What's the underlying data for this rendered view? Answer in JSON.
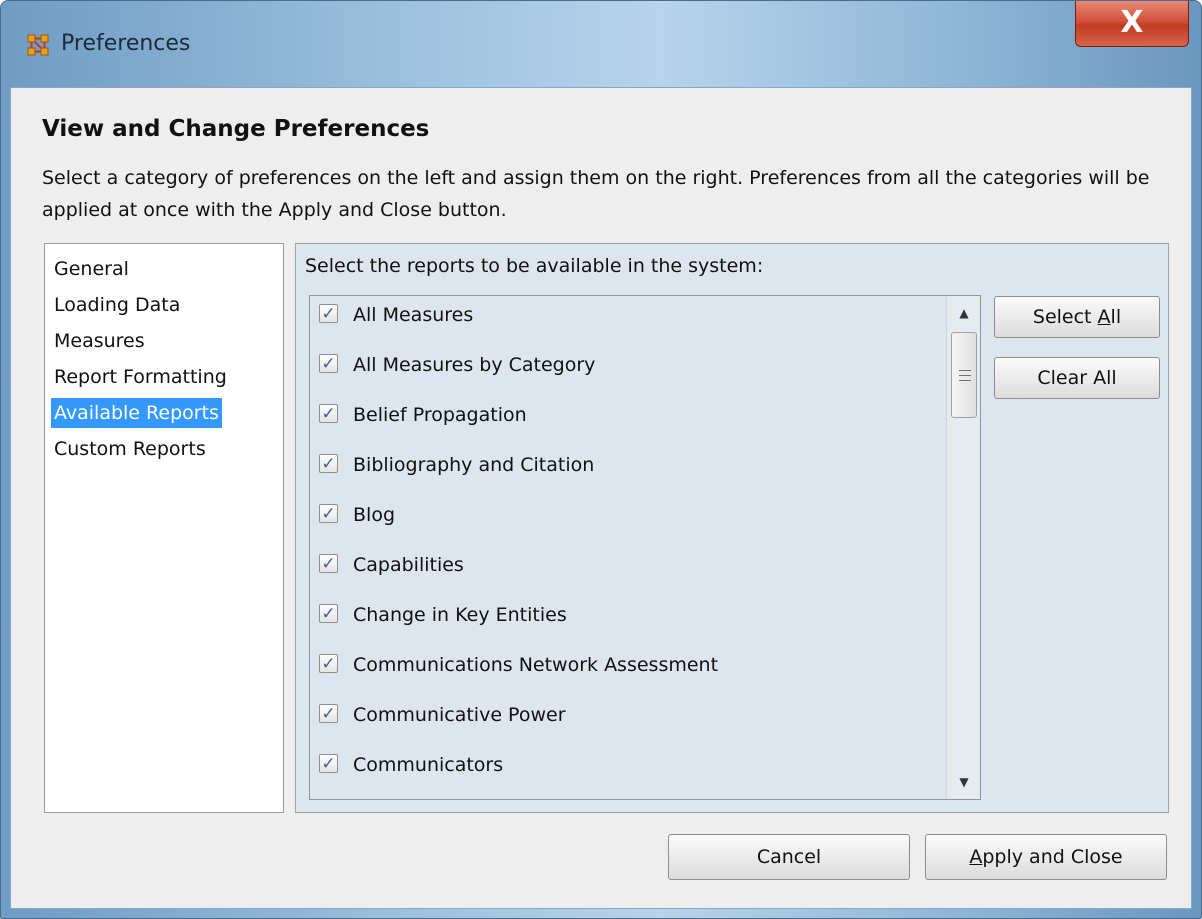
{
  "window": {
    "title": "Preferences",
    "close_label": "X",
    "icon": "network-app-icon"
  },
  "header": {
    "heading": "View and Change Preferences",
    "description": "Select a category of preferences on the left and assign them on the right. Preferences from all the categories will be applied at once with the Apply and Close button."
  },
  "categories": [
    {
      "label": "General",
      "selected": false
    },
    {
      "label": "Loading Data",
      "selected": false
    },
    {
      "label": "Measures",
      "selected": false
    },
    {
      "label": "Report Formatting",
      "selected": false
    },
    {
      "label": "Available Reports",
      "selected": true
    },
    {
      "label": "Custom Reports",
      "selected": false
    }
  ],
  "panel": {
    "label": "Select the reports to be available in the system:",
    "reports": [
      {
        "label": "All Measures",
        "checked": true
      },
      {
        "label": "All Measures by Category",
        "checked": true
      },
      {
        "label": "Belief Propagation",
        "checked": true
      },
      {
        "label": "Bibliography and Citation",
        "checked": true
      },
      {
        "label": "Blog",
        "checked": true
      },
      {
        "label": "Capabilities",
        "checked": true
      },
      {
        "label": "Change in Key Entities",
        "checked": true
      },
      {
        "label": "Communications Network Assessment",
        "checked": true
      },
      {
        "label": "Communicative Power",
        "checked": true
      },
      {
        "label": "Communicators",
        "checked": true
      }
    ],
    "select_all": {
      "before": "Select ",
      "mnemonic": "A",
      "after": "ll"
    },
    "clear_all": "Clear All"
  },
  "footer": {
    "cancel": "Cancel",
    "apply": {
      "mnemonic": "A",
      "after": "pply and Close"
    }
  },
  "colors": {
    "selection": "#3399ff",
    "close_button": "#c9432c",
    "panel_bg": "#dde5ee",
    "check": "#3a5fa0"
  }
}
